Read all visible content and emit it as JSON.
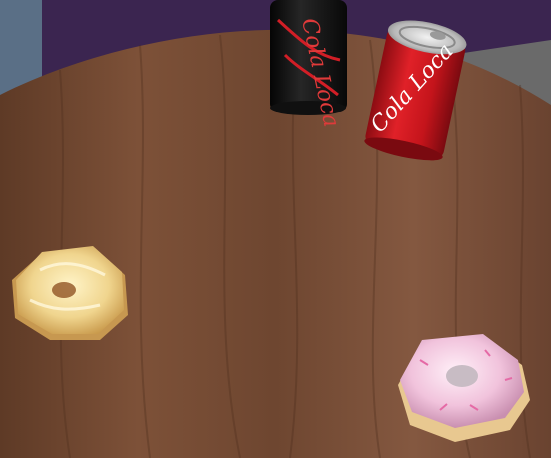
{
  "scene": {
    "type": "3d-game-viewport",
    "surface": "wooden-table",
    "colors": {
      "background": "#3b2550",
      "wall_left": "#5a6f86",
      "table_wood": "#7a4e34",
      "table_wood_dark": "#5b3723",
      "can_red": "#c8141c",
      "can_black": "#141414",
      "donut_glazed": "#f3d79a",
      "donut_pink_icing": "#f3c6e0"
    },
    "objects": {
      "can_black": {
        "label": "Cola Loca",
        "icon": "soda-can-black"
      },
      "can_red": {
        "label": "Cola Loca",
        "icon": "soda-can-red"
      },
      "donut_glazed": {
        "icon": "glazed-donut"
      },
      "donut_pink": {
        "icon": "pink-frosted-donut"
      }
    }
  }
}
